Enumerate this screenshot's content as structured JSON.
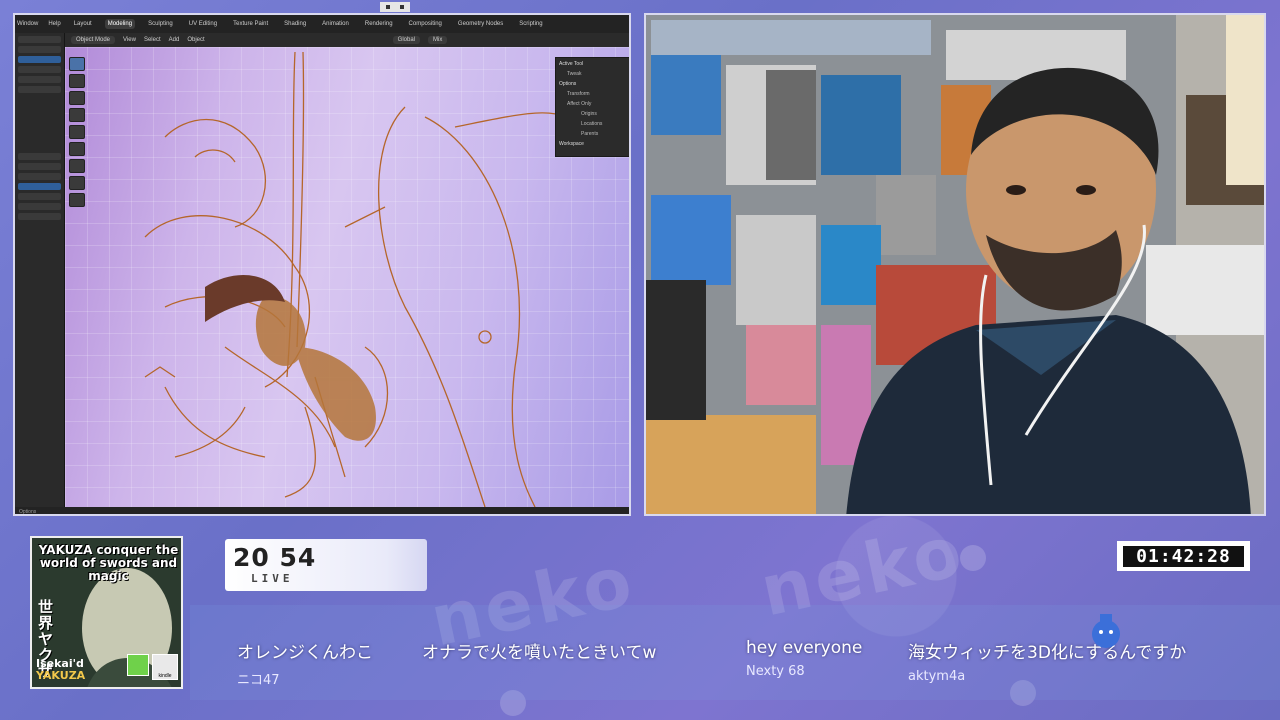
{
  "blender": {
    "menu": [
      "Window",
      "Help"
    ],
    "workspaces": [
      "Layout",
      "Modeling",
      "Sculpting",
      "UV Editing",
      "Texture Paint",
      "Shading",
      "Animation",
      "Rendering",
      "Compositing",
      "Geometry Nodes",
      "Scripting"
    ],
    "active_workspace": "Modeling",
    "header": {
      "mode": "Object Mode",
      "menus": [
        "View",
        "Select",
        "Add",
        "Object"
      ],
      "transform": "Global",
      "snap": "Mix"
    },
    "panel": {
      "active_tool": "Active Tool",
      "tool_name": "Tweak",
      "options": "Options",
      "transform": "Transform",
      "affect_only": "Affect Only",
      "origins": "Origins",
      "locations": "Locations",
      "parents": "Parents",
      "workspace": "Workspace"
    },
    "status": "Options"
  },
  "counter": {
    "number": "20 54",
    "label": "LIVE"
  },
  "timer": "01:42:28",
  "cover": {
    "title": "YAKUZA conquer the world of swords and magic",
    "jp": "世界ヤクザ",
    "sub_line1": "Isekai'd",
    "sub_line2": "YAKUZA",
    "badge": "kindle"
  },
  "chat": [
    {
      "text": "オレンジくんわこ",
      "user": "ニコ47"
    },
    {
      "text": "オナラで火を噴いたときいてw",
      "user": ""
    },
    {
      "text": "hey everyone",
      "user": "Nexty 68"
    },
    {
      "text": "海女ウィッチを3D化にするんですか",
      "user": "aktym4a"
    }
  ],
  "colors": {
    "background": "#6b73c9",
    "frame": "#d9d9ef",
    "counter_bg": "#ffffff",
    "timer_bg": "#111111"
  }
}
